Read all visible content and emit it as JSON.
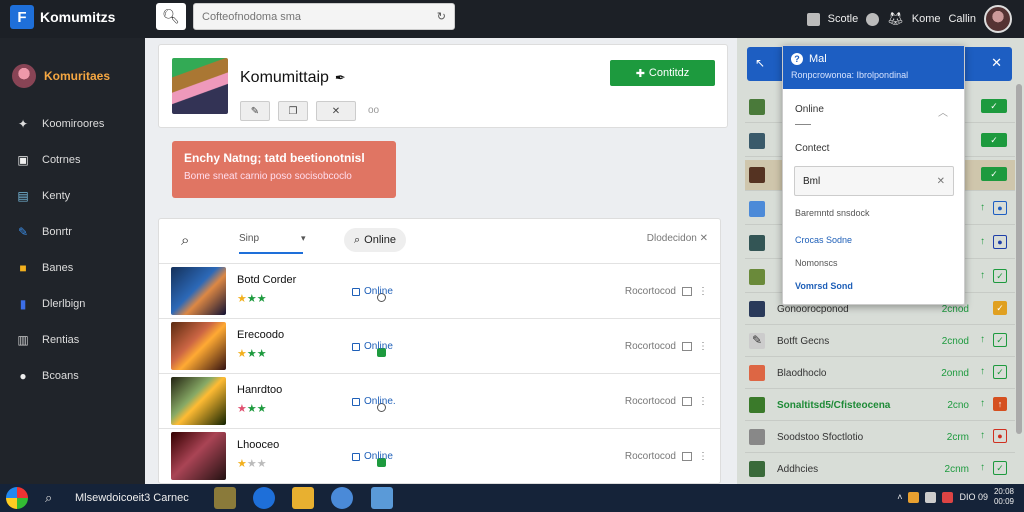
{
  "topbar": {
    "app_name": "Komumitzs",
    "search_placeholder": "Cofteofnodoma sma",
    "items": [
      "Scotle",
      "Kome",
      "Callin"
    ]
  },
  "sidebar": {
    "user": "Komuritaes",
    "items": [
      {
        "label": "Koomiroores",
        "icon": "star-icon"
      },
      {
        "label": "Cotrnes",
        "icon": "box-icon"
      },
      {
        "label": "Kenty",
        "icon": "image-icon"
      },
      {
        "label": "Bonrtr",
        "icon": "pen-icon"
      },
      {
        "label": "Banes",
        "icon": "cube-icon"
      },
      {
        "label": "Dlerlbign",
        "icon": "panel-icon"
      },
      {
        "label": "Rentias",
        "icon": "server-icon"
      },
      {
        "label": "Bcoans",
        "icon": "info-icon"
      }
    ]
  },
  "profile": {
    "name": "Komumittaip",
    "edit_icon": "✒",
    "contact_label": "Contitdz",
    "more": "oo"
  },
  "alert": {
    "title": "Enchy Natng; tatd beetionotnisl",
    "body": "Bome sneat carnio poso socisobcoclo"
  },
  "list": {
    "tab": "Sinp",
    "chip": "Online",
    "sort": "Dlodecidon",
    "rows": [
      {
        "name": "Botd Corder",
        "stars": "★★★",
        "status": "Online",
        "meta": "Rocortocod",
        "icon": "ring"
      },
      {
        "name": "Erecoodo",
        "stars": "★★★",
        "status": "Online",
        "meta": "Rocortocod",
        "icon": "square"
      },
      {
        "name": "Hanrdtoo",
        "stars": "★★★",
        "status": "Online.",
        "meta": "Rocortocod",
        "icon": "ring"
      },
      {
        "name": "Lhooceo",
        "stars": "★★★",
        "status": "Online",
        "meta": "Rocortocod",
        "icon": "square"
      }
    ]
  },
  "dropdown": {
    "title": "Mal",
    "subtitle": "Ronpcrowonoa: Ibrolpondinal",
    "online": "Online",
    "contact": "Contect",
    "field_value": "Bml",
    "line1": "Baremntd snsdock",
    "line2": "Crocas Sodne",
    "line3": "Nomonscs",
    "line4": "Vomrsd Sond"
  },
  "rpanel": {
    "rows": [
      {
        "text": "",
        "num": "",
        "chk": "✓"
      },
      {
        "text": "",
        "num": "",
        "chk": "✓"
      },
      {
        "text": "",
        "num": "",
        "chk": "✓"
      },
      {
        "text": "",
        "num": "",
        "chk": "●"
      },
      {
        "text": "",
        "num": "",
        "chk": "●"
      },
      {
        "text": "",
        "num": "",
        "chk": "✓"
      },
      {
        "text": "Gonoorocponod",
        "num": "2cnod",
        "chk": "✓"
      },
      {
        "text": "Botft Gecns",
        "num": "2cnod",
        "chk": "✓"
      },
      {
        "text": "Blaodhoclo",
        "num": "2onnd",
        "chk": "✓"
      },
      {
        "text": "Sonaltitsd5/Cfisteocena",
        "num": "2cno",
        "chk": "↑"
      },
      {
        "text": "Soodstoo Sfoctlotio",
        "num": "2crm",
        "chk": "●"
      },
      {
        "text": "Addhcies",
        "num": "2cnm",
        "chk": "✓"
      }
    ]
  },
  "taskbar": {
    "label": "Mlsewdoicoeit3 Carnec",
    "clock_top": "20:08",
    "clock_bot": "00:09",
    "tray_text": "DIO 09"
  }
}
